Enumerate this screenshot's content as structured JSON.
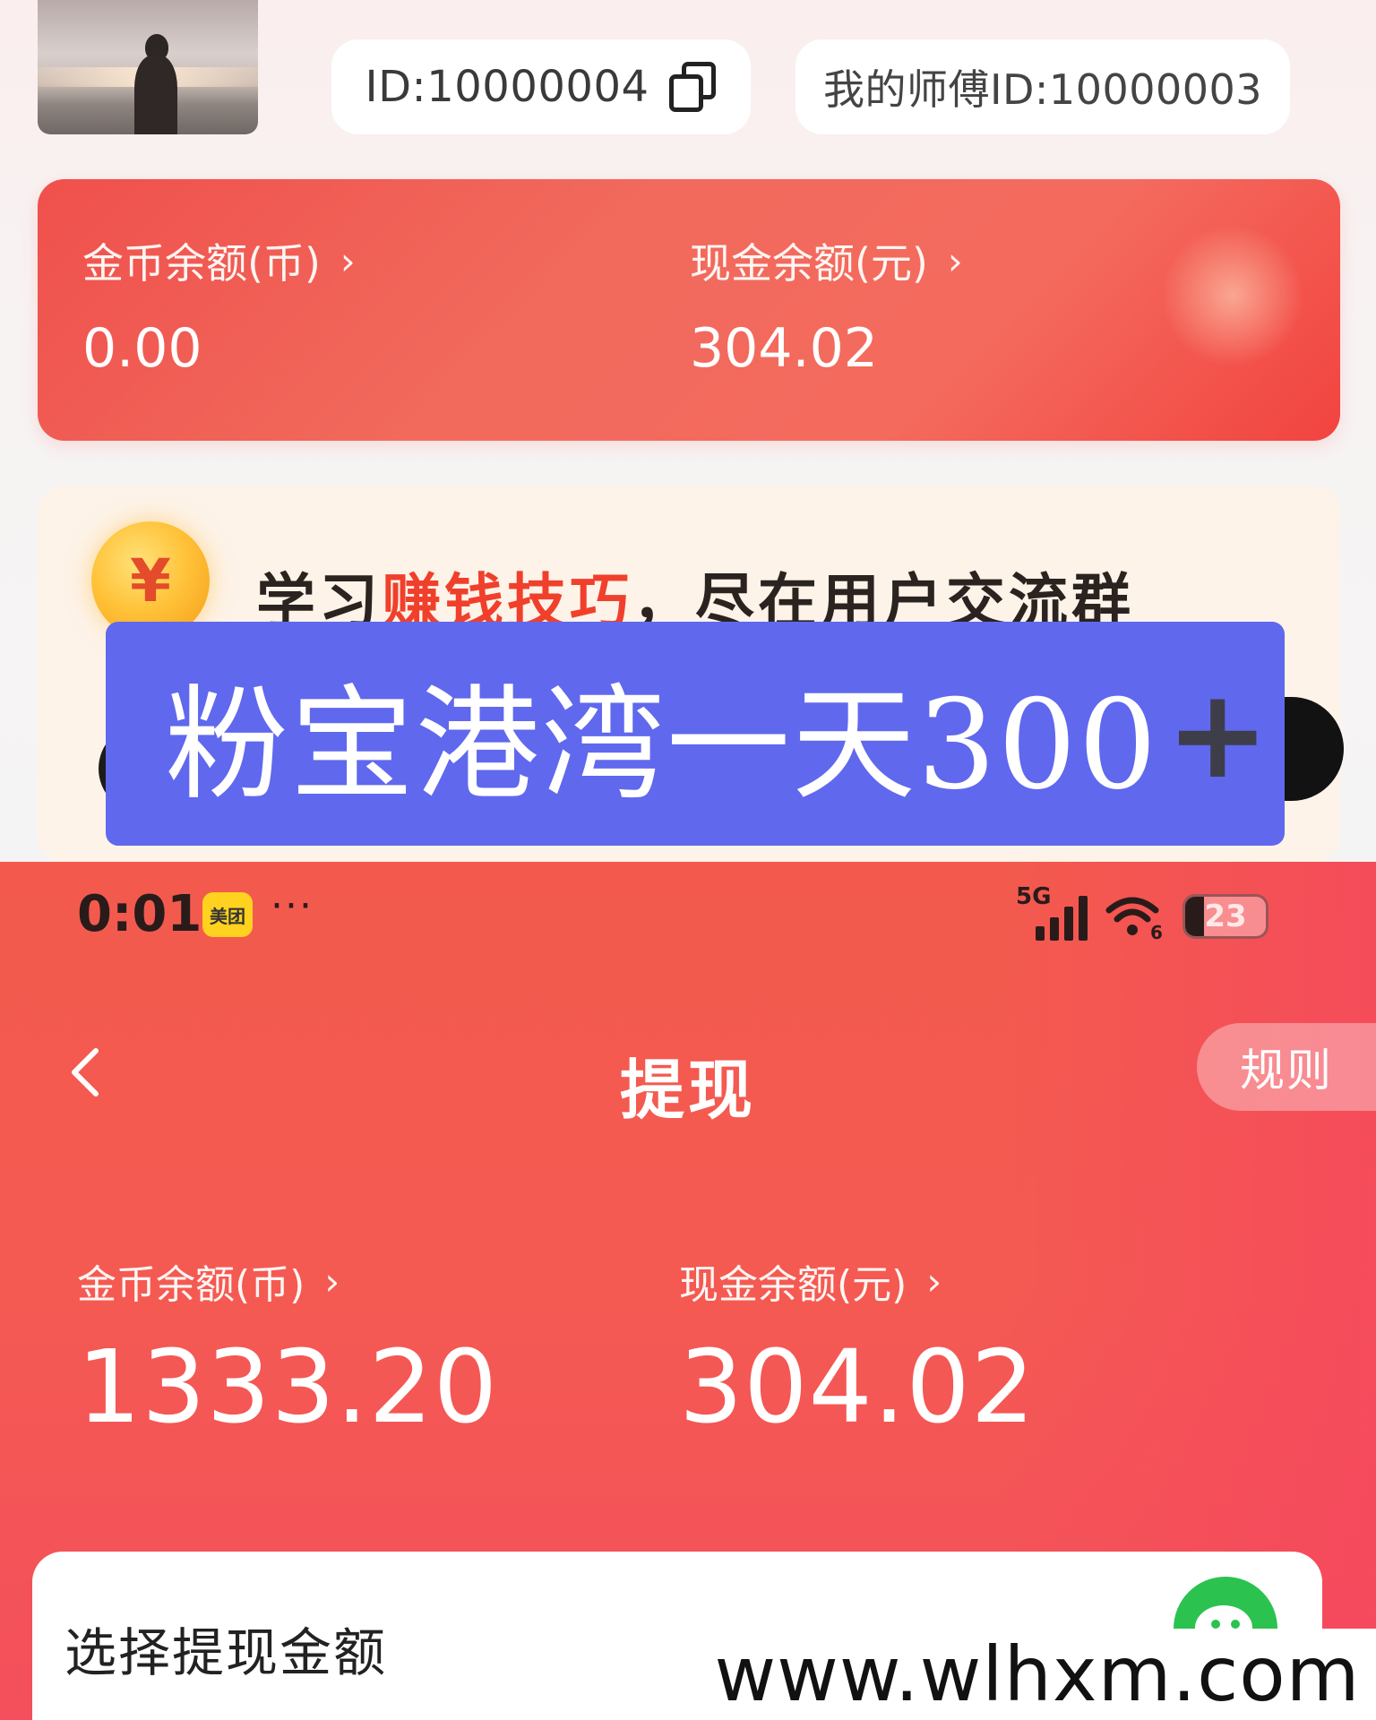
{
  "profile": {
    "user_id": "ID:10000004",
    "master_id": "我的师傅ID:10000003"
  },
  "top_balance": {
    "coin_label": "金币余额(币)",
    "coin_value": "0.00",
    "cash_label": "现金余额(元)",
    "cash_value": "304.02",
    "chevron": "›"
  },
  "banner": {
    "coin_symbol": "¥",
    "text_prefix": "学习",
    "text_highlight": "赚钱技巧",
    "text_suffix": "，尽在用户交流群"
  },
  "overlay": {
    "text": "粉宝港湾一天300",
    "plus": "+"
  },
  "status_bar": {
    "time": "0:01",
    "app_badge": "美团",
    "dots": "···",
    "network": "5G",
    "wifi_badge": "6",
    "battery": "23",
    "battery_level": 0.23
  },
  "withdraw": {
    "title": "提现",
    "rules_label": "规则",
    "coin_label": "金币余额(币)",
    "coin_value": "1333.20",
    "cash_label": "现金余额(元)",
    "cash_value": "304.02",
    "chevron": "›",
    "select_amount_title": "选择提现金额"
  },
  "watermark": "www.wlhxm.com",
  "icons": {
    "copy": "copy-icon",
    "back": "chevron-left-icon",
    "wechat": "wechat-icon",
    "coin": "coin-icon"
  },
  "colors": {
    "accent_red": "#f35a4d",
    "overlay_blue": "#6068ee",
    "highlight_red": "#f0402c",
    "wechat_green": "#2cc24f"
  }
}
